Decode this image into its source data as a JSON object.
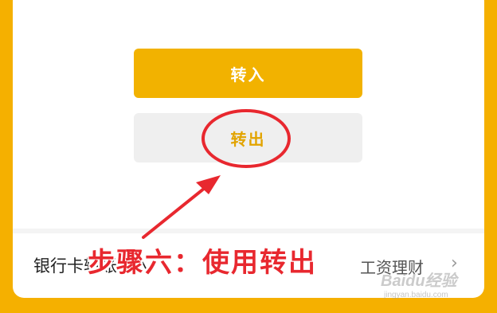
{
  "buttons": {
    "transfer_in": "转入",
    "transfer_out": "转出"
  },
  "list_row": {
    "left_label": "银行卡转账转入",
    "right_label": "工资理财",
    "chevron": "›"
  },
  "annotation": {
    "step_label": "步骤六：使用转出",
    "circle_color": "#e8282f"
  },
  "watermark": {
    "brand": "Baidu经验",
    "url": "jingyan.baidu.com"
  },
  "colors": {
    "primary": "#f2b200",
    "background": "#f5b000"
  }
}
